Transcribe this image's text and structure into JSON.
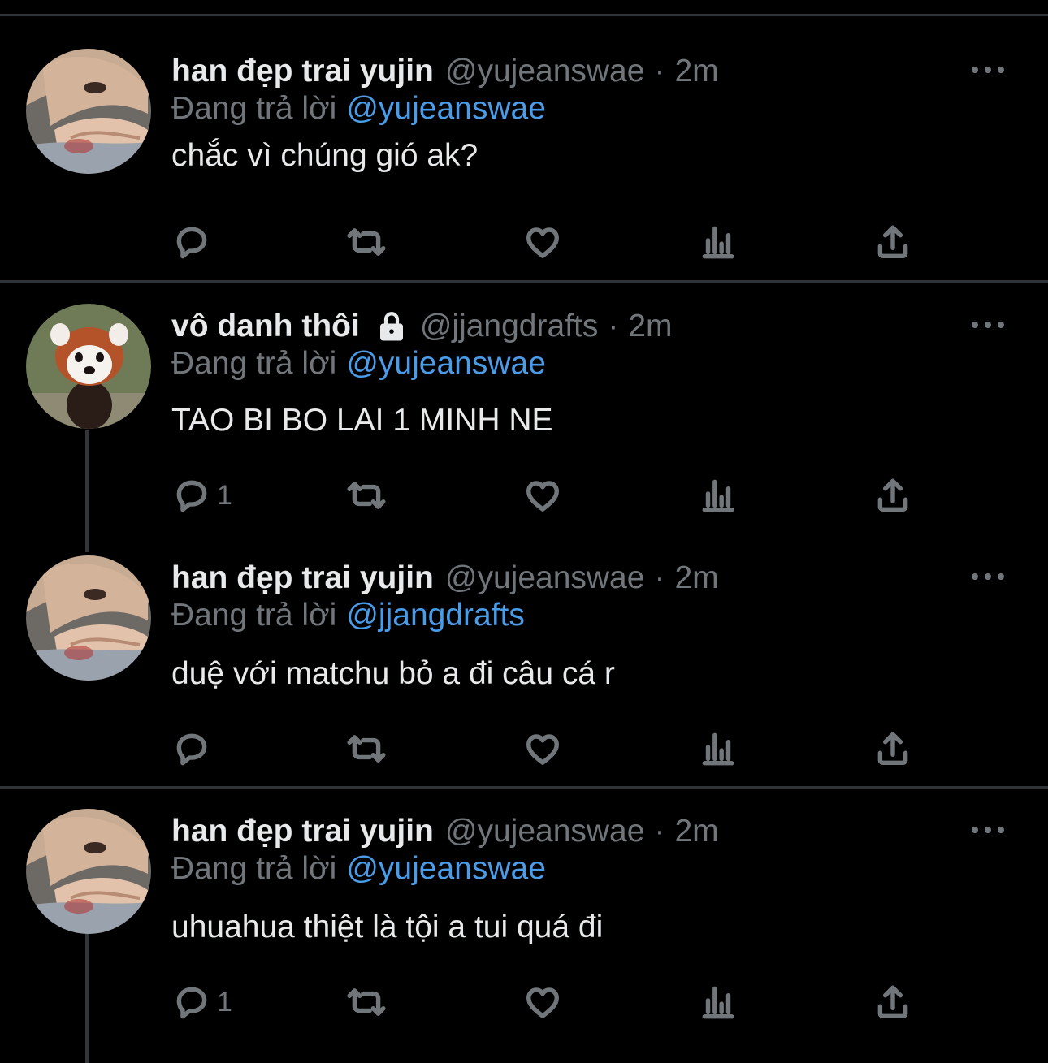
{
  "tweets": [
    {
      "display_name": "han đẹp trai yujin",
      "handle": "@yujeanswae",
      "separator": "·",
      "time": "2m",
      "reply_prefix": "Đang trả lời",
      "reply_to": "@yujeanswae",
      "text": "chắc vì chúng gió ak?",
      "reply_count": "",
      "avatar": "yujin-avatar",
      "locked": false
    },
    {
      "display_name": "vô danh thôi",
      "handle": "@jjangdrafts",
      "separator": "·",
      "time": "2m",
      "reply_prefix": "Đang trả lời",
      "reply_to": "@yujeanswae",
      "text": "TAO BI BO LAI 1 MINH NE",
      "reply_count": "1",
      "avatar": "red-panda-avatar",
      "locked": true
    },
    {
      "display_name": "han đẹp trai yujin",
      "handle": "@yujeanswae",
      "separator": "·",
      "time": "2m",
      "reply_prefix": "Đang trả lời",
      "reply_to": "@jjangdrafts",
      "text": "duệ với matchu bỏ a đi câu cá r",
      "reply_count": "",
      "avatar": "yujin-avatar",
      "locked": false
    },
    {
      "display_name": "han đẹp trai yujin",
      "handle": "@yujeanswae",
      "separator": "·",
      "time": "2m",
      "reply_prefix": "Đang trả lời",
      "reply_to": "@yujeanswae",
      "text": "uhuahua thiệt là tội a tui quá đi",
      "reply_count": "1",
      "avatar": "yujin-avatar",
      "locked": false
    }
  ],
  "colors": {
    "background": "#000000",
    "text_primary": "#e7e9ea",
    "text_secondary": "#71767b",
    "mention": "#4a9ce9",
    "divider": "#2f3336"
  },
  "icons": [
    "reply-icon",
    "retweet-icon",
    "like-icon",
    "views-icon",
    "share-icon",
    "more-icon",
    "lock-icon"
  ]
}
